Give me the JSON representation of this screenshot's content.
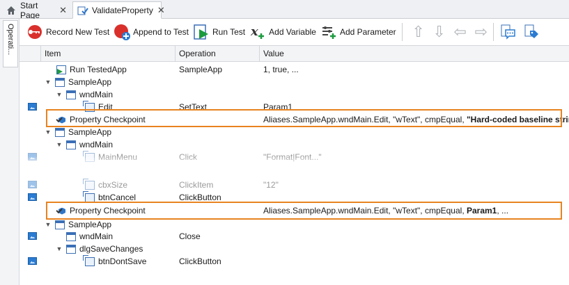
{
  "tabs": [
    {
      "label": "Start Page",
      "icon": "home-icon"
    },
    {
      "label": "ValidateProperty",
      "icon": "keyword-test-icon"
    }
  ],
  "side_tab": {
    "label": "Operati..."
  },
  "toolbar": {
    "record_label": "Record New Test",
    "append_label": "Append to Test",
    "run_label": "Run Test",
    "add_variable_label": "Add Variable",
    "add_parameter_label": "Add Parameter"
  },
  "columns": {
    "item": "Item",
    "operation": "Operation",
    "value": "Value"
  },
  "rows": [
    {
      "item": "Run TestedApp",
      "op": "SampleApp",
      "val": "1, true, ..."
    },
    {
      "item": "SampleApp",
      "op": "",
      "val": ""
    },
    {
      "item": "wndMain",
      "op": "",
      "val": ""
    },
    {
      "item": "Edit",
      "op": "SetText",
      "val": "Param1"
    },
    {
      "item": "Property Checkpoint",
      "op": "",
      "val_pre": "Aliases.SampleApp.wndMain.Edit, \"wText\", cmpEqual, ",
      "val_bold": "\"Hard-coded baseline string\""
    },
    {
      "item": "SampleApp",
      "op": "",
      "val": ""
    },
    {
      "item": "wndMain",
      "op": "",
      "val": ""
    },
    {
      "item": "MainMenu",
      "op": "Click",
      "val": "\"Format|Font...\""
    },
    {
      "item": "cbxSize",
      "op": "ClickItem",
      "val": "\"12\""
    },
    {
      "item": "btnCancel",
      "op": "ClickButton",
      "val": ""
    },
    {
      "item": "Property Checkpoint",
      "op": "",
      "val_pre": "Aliases.SampleApp.wndMain.Edit, \"wText\", cmpEqual, ",
      "val_bold": "Param1",
      "val_post": ", ..."
    },
    {
      "item": "SampleApp",
      "op": "",
      "val": ""
    },
    {
      "item": "wndMain",
      "op": "Close",
      "val": ""
    },
    {
      "item": "dlgSaveChanges",
      "op": "",
      "val": ""
    },
    {
      "item": "btnDontSave",
      "op": "ClickButton",
      "val": ""
    }
  ],
  "colors": {
    "highlight": "#e8831f",
    "accent": "#2a7bd1"
  }
}
